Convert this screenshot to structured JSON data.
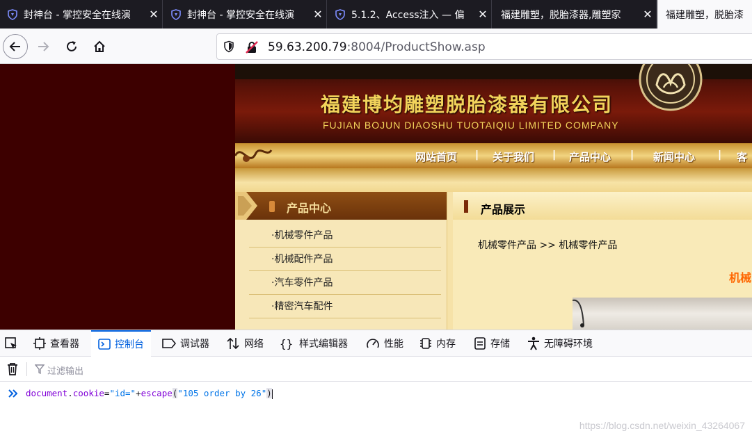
{
  "tabs": [
    {
      "title": "封神台 - 掌控安全在线演"
    },
    {
      "title": "封神台 - 掌控安全在线演"
    },
    {
      "title": "5.1.2、Access注入 — 偏"
    },
    {
      "title": "福建雕塑，脱胎漆器,雕塑家"
    },
    {
      "title": "福建雕塑，脱胎漆"
    }
  ],
  "nav": {
    "url_host": "59.63.200.79",
    "url_rest": ":8004/ProductShow.asp"
  },
  "site": {
    "company_cn": "福建博均雕塑脱胎漆器有限公司",
    "company_en": "FUJIAN BOJUN DIAOSHU  TUOTAIQIU  LIMITED COMPANY",
    "menu": [
      "网站首页",
      "关于我们",
      "产品中心",
      "新闻中心",
      "客"
    ],
    "menu_sep": "|",
    "left_title": "产品中心",
    "left_links": [
      "·机械零件产品",
      "·机械配件产品",
      "·汽车零件产品",
      "·精密汽车配件"
    ],
    "right_title": "产品展示",
    "breadcrumb": "机械零件产品 >> 机械零件产品",
    "product_heading": "机械"
  },
  "devtools": {
    "tabs": [
      "查看器",
      "控制台",
      "调试器",
      "网络",
      "样式编辑器",
      "性能",
      "内存",
      "存储",
      "无障碍环境"
    ],
    "active_tab": "控制台",
    "filter_placeholder": "过滤输出",
    "console": {
      "obj": "document",
      "dot": ".",
      "prop": "cookie",
      "eq": "=",
      "s1": "\"id=\"",
      "plus": "+",
      "fn": "escape",
      "open": "(",
      "s2": "\"105 order by 26\"",
      "close": ")"
    }
  },
  "watermark": "https://blog.csdn.net/weixin_43264067"
}
